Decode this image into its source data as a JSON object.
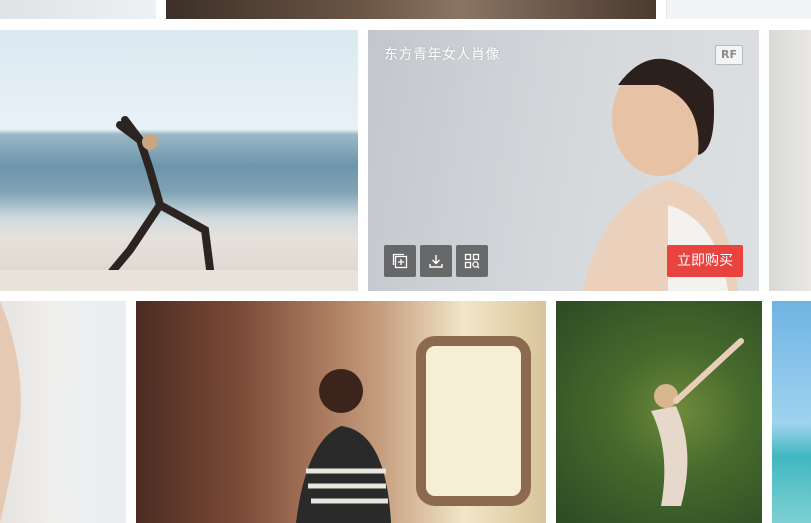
{
  "gallery": {
    "hovered": {
      "title": "东方青年女人肖像",
      "license_badge": "RF",
      "buy_label": "立即购买",
      "actions": [
        "add-to-collection",
        "download",
        "find-similar"
      ]
    }
  },
  "colors": {
    "buy_button": "#e8433f",
    "action_button_bg": "#464646",
    "badge_border": "#b9b9b9"
  }
}
